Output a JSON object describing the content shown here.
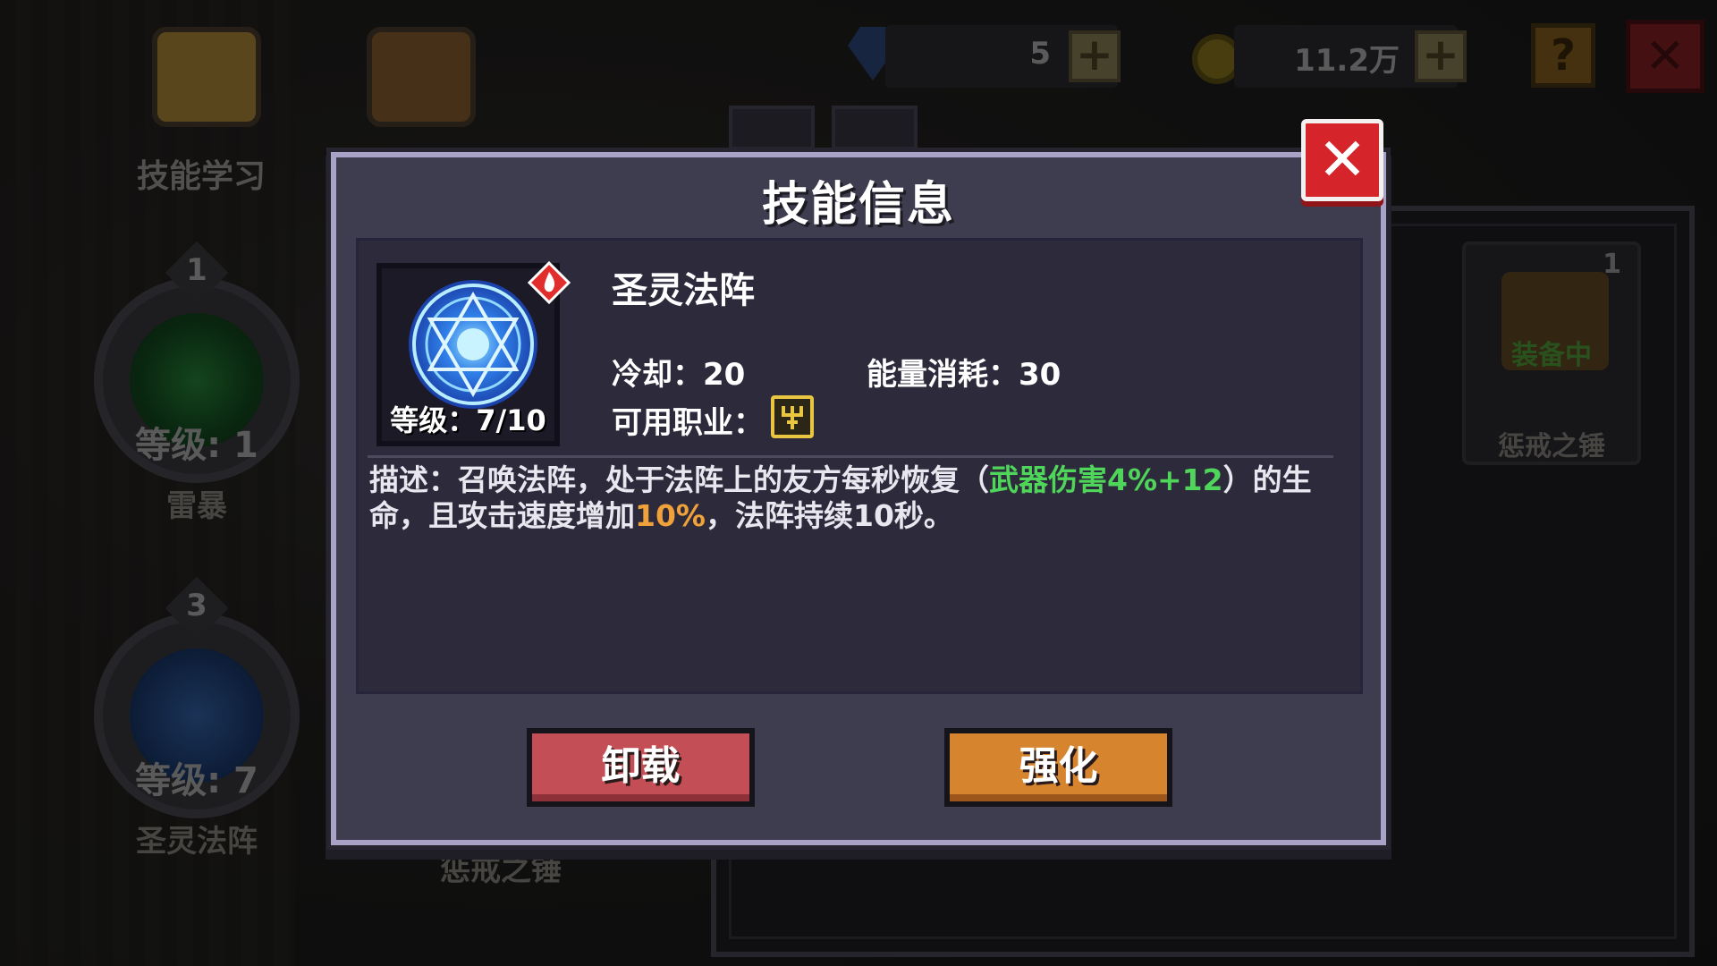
{
  "hud": {
    "gems": "5",
    "coins": "11.2万",
    "plus_label": "+",
    "help_label": "?",
    "exit_label": "✕"
  },
  "background": {
    "top_icons": [
      {
        "label": "技能学习"
      },
      {
        "label": ""
      }
    ],
    "skills": [
      {
        "rank": "1",
        "level": "等级: 1",
        "name": "雷暴"
      },
      {
        "rank": "3",
        "level": "等级: 7",
        "name": "圣灵法阵"
      }
    ],
    "bottom_label_2": "惩戒之锤",
    "right_card": {
      "rank": "1",
      "status": "装备中",
      "name": "惩戒之锤"
    }
  },
  "modal": {
    "title": "技能信息",
    "close_label": "✕",
    "skill": {
      "name": "圣灵法阵",
      "level_text": "等级：7/10",
      "cooldown_label": "冷却：",
      "cooldown_value": "20",
      "energy_label": "能量消耗：",
      "energy_value": "30",
      "class_label": "可用职业："
    },
    "description": {
      "part1": "描述：召唤法阵，处于法阵上的友方每秒恢复（",
      "highlight_green": "武器伤害4%+12",
      "part2": "）的生命，且攻击速度增加",
      "highlight_orange": "10%",
      "part3": "，法阵持续10秒。"
    },
    "buttons": {
      "unequip": "卸载",
      "upgrade": "强化"
    }
  },
  "colors": {
    "modal_bg": "#3e3c4f",
    "close_red": "#d6252a",
    "unequip_red": "#c44e55",
    "upgrade_orange": "#d7842f",
    "highlight_green": "#4fd55a",
    "highlight_orange": "#f1a13a"
  }
}
